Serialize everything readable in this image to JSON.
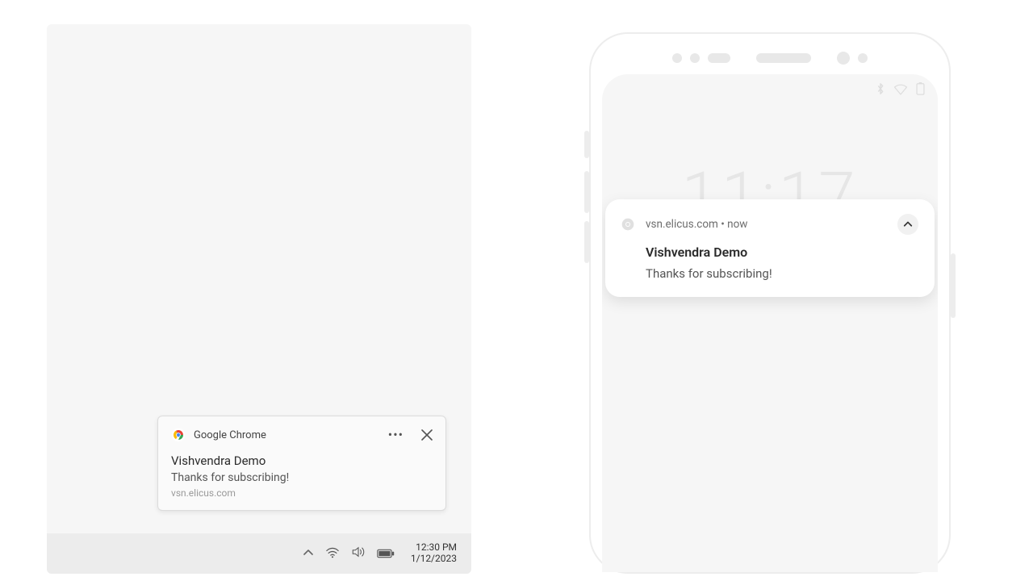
{
  "desktop": {
    "notification": {
      "app_name": "Google Chrome",
      "title": "Vishvendra Demo",
      "body": "Thanks for subscribing!",
      "domain": "vsn.elicus.com"
    },
    "taskbar": {
      "time": "12:30 PM",
      "date": "1/12/2023"
    }
  },
  "mobile": {
    "lock_clock": "11:17",
    "notification": {
      "source": "vsn.elicus.com • now",
      "title": "Vishvendra Demo",
      "body": "Thanks for subscribing!"
    }
  }
}
